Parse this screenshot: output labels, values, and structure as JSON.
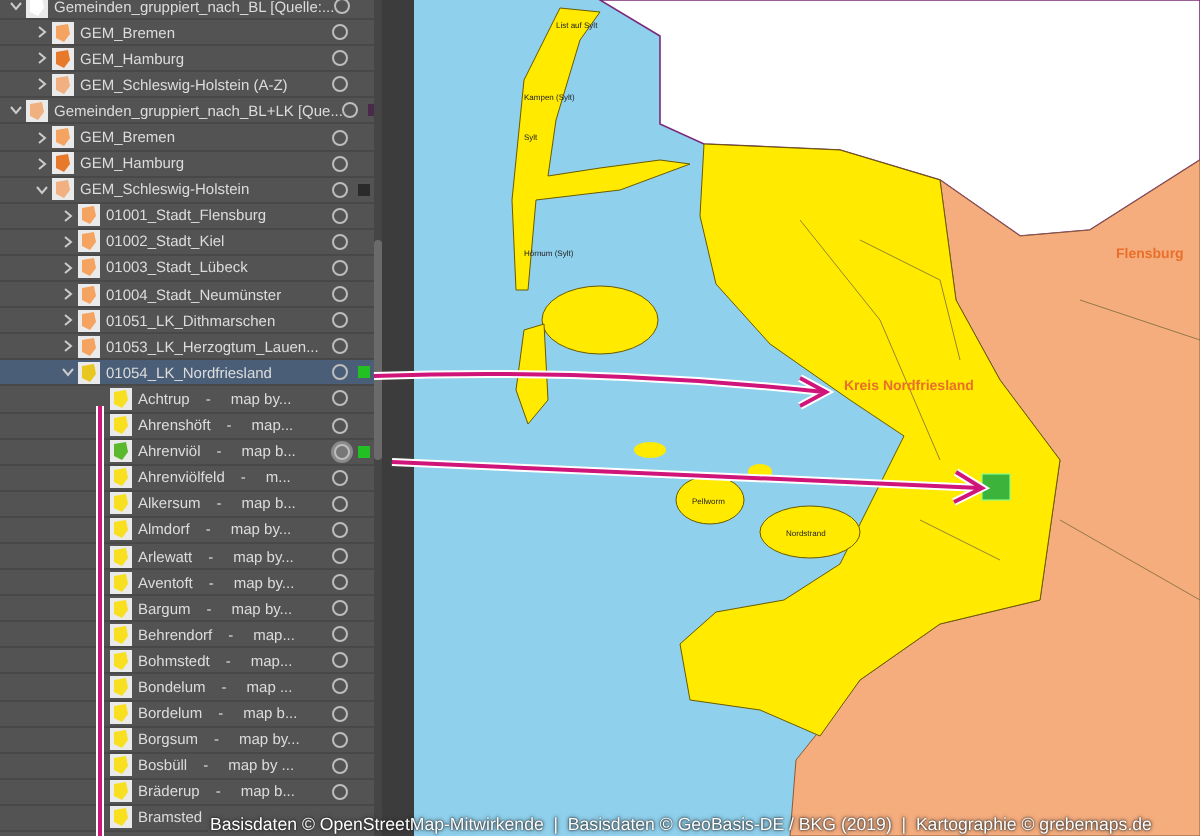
{
  "layers": [
    {
      "name": "Gemeinden_gruppiert_nach_BL [Quelle:...",
      "kind": "group",
      "expanded": true,
      "selected": false,
      "targeted": false,
      "color": "#ffffff",
      "children": [
        {
          "name": "GEM_Bremen",
          "kind": "group",
          "expanded": false,
          "selected": false,
          "targeted": false,
          "color": "#f4a460"
        },
        {
          "name": "GEM_Hamburg",
          "kind": "group",
          "expanded": false,
          "selected": false,
          "targeted": false,
          "color": "#e8782a"
        },
        {
          "name": "GEM_Schleswig-Holstein (A-Z)",
          "kind": "group",
          "expanded": false,
          "selected": false,
          "targeted": false,
          "color": "#f0b080"
        }
      ]
    },
    {
      "name": "Gemeinden_gruppiert_nach_BL+LK [Que...",
      "kind": "group",
      "expanded": true,
      "selected": false,
      "targeted": false,
      "color": "#f0b080",
      "marker": {
        "color": "#4a2a4a"
      },
      "children": [
        {
          "name": "GEM_Bremen",
          "kind": "group",
          "expanded": false,
          "selected": false,
          "targeted": false,
          "color": "#f4a460"
        },
        {
          "name": "GEM_Hamburg",
          "kind": "group",
          "expanded": false,
          "selected": false,
          "targeted": false,
          "color": "#e8782a"
        },
        {
          "name": "GEM_Schleswig-Holstein",
          "kind": "group",
          "expanded": true,
          "selected": false,
          "targeted": false,
          "color": "#f0b080",
          "marker": {
            "color": "#2a2a2a"
          },
          "children": [
            {
              "name": "01001_Stadt_Flensburg",
              "kind": "group",
              "expanded": false,
              "selected": false,
              "targeted": false,
              "color": "#f4a460"
            },
            {
              "name": "01002_Stadt_Kiel",
              "kind": "group",
              "expanded": false,
              "selected": false,
              "targeted": false,
              "color": "#f4a460"
            },
            {
              "name": "01003_Stadt_Lübeck",
              "kind": "group",
              "expanded": false,
              "selected": false,
              "targeted": false,
              "color": "#f4a460"
            },
            {
              "name": "01004_Stadt_Neumünster",
              "kind": "group",
              "expanded": false,
              "selected": false,
              "targeted": false,
              "color": "#f4a460"
            },
            {
              "name": "01051_LK_Dithmarschen",
              "kind": "group",
              "expanded": false,
              "selected": false,
              "targeted": false,
              "color": "#f4a460"
            },
            {
              "name": "01053_LK_Herzogtum_Lauen...",
              "kind": "group",
              "expanded": false,
              "selected": false,
              "targeted": false,
              "color": "#f4a460"
            },
            {
              "name": "01054_LK_Nordfriesland",
              "kind": "group",
              "expanded": true,
              "selected": true,
              "targeted": false,
              "color": "#e8c820",
              "marker": {
                "color": "#22c022"
              },
              "children": [
                {
                  "name": "Achtrup",
                  "separator": "-",
                  "credit": "map by...",
                  "kind": "item",
                  "selected": false,
                  "targeted": false,
                  "color": "#f8e020"
                },
                {
                  "name": "Ahrenshöft",
                  "separator": "-",
                  "credit": "map...",
                  "kind": "item",
                  "selected": false,
                  "targeted": false,
                  "color": "#f8e020"
                },
                {
                  "name": "Ahrenviöl",
                  "separator": "-",
                  "credit": "map b...",
                  "kind": "item",
                  "selected": false,
                  "targeted": true,
                  "color": "#5cb82c",
                  "marker": {
                    "color": "#22c022"
                  }
                },
                {
                  "name": "Ahrenviölfeld",
                  "separator": "-",
                  "credit": "m...",
                  "kind": "item",
                  "selected": false,
                  "targeted": false,
                  "color": "#f8e020"
                },
                {
                  "name": "Alkersum",
                  "separator": "-",
                  "credit": "map b...",
                  "kind": "item",
                  "selected": false,
                  "targeted": false,
                  "color": "#f8e020"
                },
                {
                  "name": "Almdorf",
                  "separator": "-",
                  "credit": "map by...",
                  "kind": "item",
                  "selected": false,
                  "targeted": false,
                  "color": "#f8e020"
                },
                {
                  "name": "Arlewatt",
                  "separator": "-",
                  "credit": "map by...",
                  "kind": "item",
                  "selected": false,
                  "targeted": false,
                  "color": "#f8e020"
                },
                {
                  "name": "Aventoft",
                  "separator": "-",
                  "credit": "map by...",
                  "kind": "item",
                  "selected": false,
                  "targeted": false,
                  "color": "#f8e020"
                },
                {
                  "name": "Bargum",
                  "separator": "-",
                  "credit": "map by...",
                  "kind": "item",
                  "selected": false,
                  "targeted": false,
                  "color": "#f8e020"
                },
                {
                  "name": "Behrendorf",
                  "separator": "-",
                  "credit": "map...",
                  "kind": "item",
                  "selected": false,
                  "targeted": false,
                  "color": "#f8e020"
                },
                {
                  "name": "Bohmstedt",
                  "separator": "-",
                  "credit": "map...",
                  "kind": "item",
                  "selected": false,
                  "targeted": false,
                  "color": "#f8e020"
                },
                {
                  "name": "Bondelum",
                  "separator": "-",
                  "credit": "map ...",
                  "kind": "item",
                  "selected": false,
                  "targeted": false,
                  "color": "#f8e020"
                },
                {
                  "name": "Bordelum",
                  "separator": "-",
                  "credit": "map b...",
                  "kind": "item",
                  "selected": false,
                  "targeted": false,
                  "color": "#f8e020"
                },
                {
                  "name": "Borgsum",
                  "separator": "-",
                  "credit": "map by...",
                  "kind": "item",
                  "selected": false,
                  "targeted": false,
                  "color": "#f8e020"
                },
                {
                  "name": "Bosbüll",
                  "separator": "-",
                  "credit": "map by ...",
                  "kind": "item",
                  "selected": false,
                  "targeted": false,
                  "color": "#f8e020"
                },
                {
                  "name": "Bräderup",
                  "separator": "-",
                  "credit": "map b...",
                  "kind": "item",
                  "selected": false,
                  "targeted": false,
                  "color": "#f8e020"
                },
                {
                  "name": "Bramsted",
                  "kind": "item",
                  "selected": false,
                  "color": "#f8e020"
                }
              ]
            }
          ]
        }
      ]
    }
  ],
  "map": {
    "labels": [
      {
        "text": "List auf Sylt",
        "kind": "place"
      },
      {
        "text": "Kampen (Sylt)",
        "kind": "place"
      },
      {
        "text": "Sylt",
        "kind": "place"
      },
      {
        "text": "Hörnum (Sylt)",
        "kind": "place"
      },
      {
        "text": "Pellworm",
        "kind": "place"
      },
      {
        "text": "Nordstrand",
        "kind": "place"
      },
      {
        "text": "Flensburg",
        "kind": "city"
      },
      {
        "text": "Kreis Nordfriesland",
        "kind": "district"
      }
    ]
  },
  "credits": "Basisdaten © OpenStreetMap-Mitwirkende  |  Basisdaten © GeoBasis-DE / BKG (2019)  |  Kartographie © grebemaps.de"
}
